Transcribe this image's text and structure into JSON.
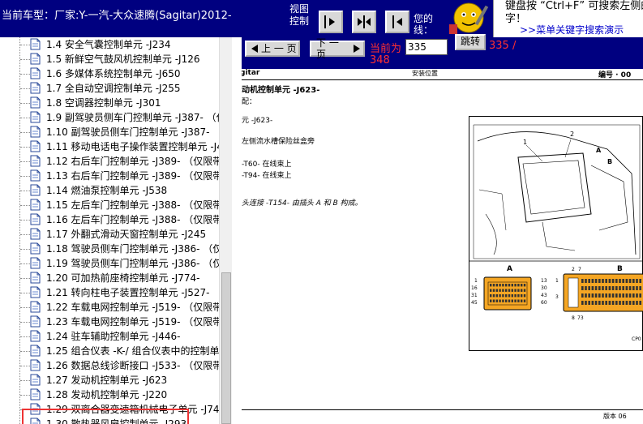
{
  "header": {
    "title": "当前车型：厂家:Y-一汽-大众速腾(Sagitar)2012-",
    "view_control_line1": "视图",
    "view_control_line2": "控制",
    "your_path_label": "您的线：",
    "tip_line1": "键盘按 “Ctrl+F” 可搜索左侧的",
    "tip_line2": "字！",
    "tip_link": ">>菜单关键字搜索演示"
  },
  "nav": {
    "prev_label": "上 一 页",
    "next_label": "下 一 页",
    "current_label": "当前为",
    "page_value": "335",
    "jump_label": "跳转",
    "page_count": "335 /",
    "page_total": "348"
  },
  "tree": {
    "items": [
      {
        "label": "1.4 安全气囊控制单元 -J234"
      },
      {
        "label": "1.5 新鲜空气鼓风机控制单元 -J126"
      },
      {
        "label": "1.6 多媒体系统控制单元 -J650"
      },
      {
        "label": "1.7 全自动空调控制单元 -J255"
      },
      {
        "label": "1.8 空调器控制单元 -J301"
      },
      {
        "label": "1.9 副驾驶员侧车门控制单元 -J387- （仅限"
      },
      {
        "label": "1.10 副驾驶员侧车门控制单元 -J387- （仅"
      },
      {
        "label": "1.11 移动电话电子操作装置控制单元 -J412"
      },
      {
        "label": "1.12 右后车门控制单元 -J389- （仅限带 P"
      },
      {
        "label": "1.13 右后车门控制单元 -J389- （仅限带 P"
      },
      {
        "label": "1.14 燃油泵控制单元 -J538"
      },
      {
        "label": "1.15 左后车门控制单元 -J388- （仅限带 P"
      },
      {
        "label": "1.16 左后车门控制单元 -J388- （仅限带 P"
      },
      {
        "label": "1.17 外翻式滑动天窗控制单元 -J245"
      },
      {
        "label": "1.18 驾驶员侧车门控制单元 -J386- （仅限"
      },
      {
        "label": "1.19 驾驶员侧车门控制单元 -J386- （仅限"
      },
      {
        "label": "1.20 可加热前座椅控制单元 -J774-"
      },
      {
        "label": "1.21 转向柱电子装置控制单元 -J527- （仅"
      },
      {
        "label": "1.22 车载电网控制单元 -J519- （仅限带 P"
      },
      {
        "label": "1.23 车载电网控制单元 -J519- （仅限带 P"
      },
      {
        "label": "1.24 驻车辅助控制单元 -J446-"
      },
      {
        "label": "1.25 组合仪表 -K-/ 组合仪表中的控制单元"
      },
      {
        "label": "1.26 数据总线诊断接口 -J533- （仅限带 P"
      },
      {
        "label": "1.27 发动机控制单元 -J623"
      },
      {
        "label": "1.28 发动机控制单元 -J220"
      },
      {
        "label": "1.29 双离合器变速箱机械电子单元 -J743"
      },
      {
        "label": "1.30 散热器风扇控制单元 -J293-"
      }
    ]
  },
  "document": {
    "header_left": "gitar",
    "header_mid": "安装位置",
    "header_right": "编号 · 00",
    "heading": "动机控制单元 -J623-",
    "line1": "配：",
    "line2": "元 -J623-",
    "line3": "左侧流水槽保险丝盒旁",
    "line4": "-T60- 在线束上",
    "line5": "-T94- 在线束上",
    "line6": "头连接 -T154- 由插头 A 和 B 构成。",
    "footer": "版本 06",
    "connector_a": "A",
    "connector_b": "B",
    "pin_a_left": [
      "1",
      "16",
      "31",
      "45"
    ],
    "pin_a_right": [
      "13",
      "30",
      "43",
      "60"
    ],
    "pin_b_top": [
      "2",
      "7"
    ],
    "pin_b_bottom": [
      "8",
      "73"
    ],
    "pin_b_left": [
      "1",
      "",
      "3"
    ],
    "fig_label_1": "1",
    "fig_label_a": "A",
    "fig_label_b": "B",
    "fig_label_2": "2",
    "fig_code": "CP0"
  }
}
